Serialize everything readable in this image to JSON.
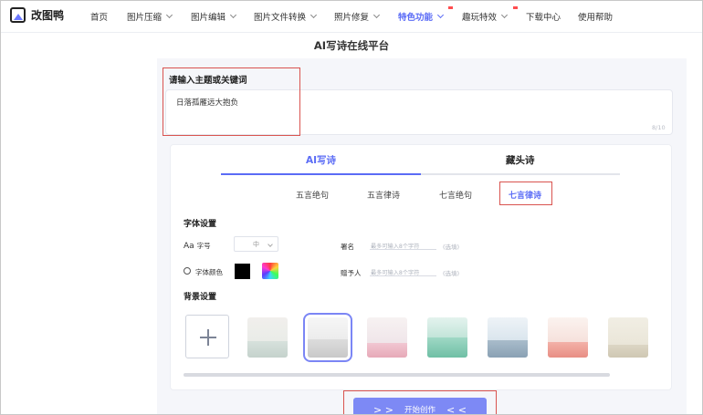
{
  "nav": {
    "logo_text": "改图鸭",
    "items": [
      {
        "label": "首页",
        "dropdown": false
      },
      {
        "label": "图片压缩",
        "dropdown": true
      },
      {
        "label": "图片编辑",
        "dropdown": true
      },
      {
        "label": "图片文件转换",
        "dropdown": true
      },
      {
        "label": "照片修复",
        "dropdown": true
      },
      {
        "label": "特色功能",
        "dropdown": true,
        "active": true,
        "hot": true
      },
      {
        "label": "趣玩特效",
        "dropdown": true,
        "hot": true
      },
      {
        "label": "下载中心",
        "dropdown": false
      },
      {
        "label": "使用帮助",
        "dropdown": false
      }
    ]
  },
  "page_title": "AI写诗在线平台",
  "input": {
    "label": "请输入主题或关键词",
    "value": "日落孤雁远大抱负",
    "counter": "8/10"
  },
  "tabs": [
    {
      "label": "AI写诗",
      "active": true
    },
    {
      "label": "藏头诗",
      "active": false
    }
  ],
  "subtabs": [
    {
      "label": "五言绝句",
      "active": false
    },
    {
      "label": "五言律诗",
      "active": false
    },
    {
      "label": "七言绝句",
      "active": false
    },
    {
      "label": "七言律诗",
      "active": true
    }
  ],
  "font_settings": {
    "title": "字体设置",
    "size_icon_text": "Aa",
    "size_label": "字号",
    "size_value": "中",
    "color_label": "字体颜色",
    "color_value": "#000000",
    "signature_label": "署名",
    "signature_placeholder": "最多可输入8个字符",
    "signature_optional": "(选填)",
    "gift_label": "赠予人",
    "gift_placeholder": "最多可输入8个字符",
    "gift_optional": "(选填)"
  },
  "background_settings": {
    "title": "背景设置",
    "add_icon": "plus-icon",
    "selected_index": 1,
    "thumbnails": 7
  },
  "start_button": {
    "label": "开始创作",
    "left_arrows": "> >",
    "right_arrows": "< <"
  },
  "colors": {
    "accent": "#5b6cf6",
    "button": "#7d89f5",
    "highlight_box": "#d9534f"
  }
}
